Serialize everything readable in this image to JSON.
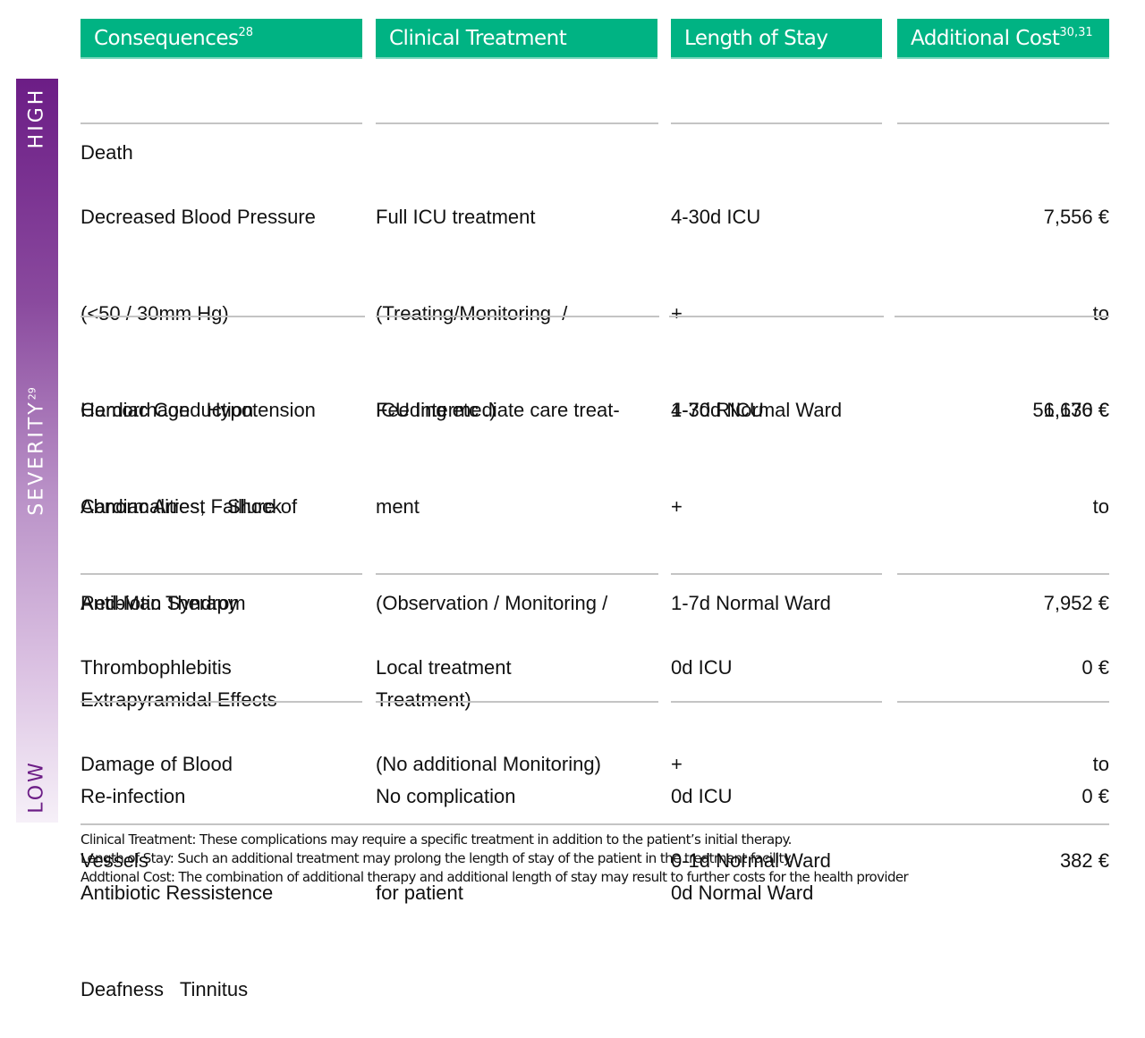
{
  "headers": {
    "consequences": {
      "label": "Consequences",
      "sup": "28"
    },
    "clinical_treatment": {
      "label": "Clinical Treatment"
    },
    "length_of_stay": {
      "label": "Length of Stay"
    },
    "additional_cost": {
      "label": "Additional Cost",
      "sup": "30,31"
    }
  },
  "severity_scale": {
    "high": "HIGH",
    "mid": "SEVERITY",
    "mid_sup": "29",
    "low": "LOW",
    "top_color": "#6c1d86",
    "bottom_color": "#f6f0f8"
  },
  "colors": {
    "header_bg": "#00b383",
    "rule": "#c4c4c4"
  },
  "rows": [
    {
      "consequences": [
        "Death"
      ],
      "treatment": [],
      "stay": [],
      "cost": []
    },
    {
      "consequences": [
        "Decreased Blood Pressure",
        "(<50 / 30mm Hg)",
        "Hemorrhage   Hypotension",
        "Cardiac Arrest    Shock",
        "Red-Man Syndrom"
      ],
      "treatment": [
        "Full ICU treatment",
        "(Treating/Monitoring  /",
        "Feeding etc .)"
      ],
      "stay": [
        "4-30d ICU",
        "+",
        "4-30d Normal Ward"
      ],
      "cost": [
        "7,556 €",
        "to",
        "56,670 €"
      ]
    },
    {
      "consequences": [
        "Cardiac Conduction",
        "Abnormalities, Faillure of",
        "Antibiotic Therapy",
        "Extrapyramidal Effects",
        "Re-infection",
        "Antibiotic Ressistence",
        "Deafness   Tinnitus"
      ],
      "treatment": [
        "ICU Intermediate care treat-",
        "ment",
        "(Observation / Monitoring /",
        "Treatment)"
      ],
      "stay": [
        "1-7d RICU",
        "+",
        "1-7d Normal Ward"
      ],
      "cost": [
        "1,136 €",
        "to",
        "7,952 €"
      ]
    },
    {
      "consequences": [
        "Thrombophlebitis",
        "Damage of Blood",
        "Vessels"
      ],
      "treatment": [
        "Local treatment",
        "(No additional Monitoring)"
      ],
      "stay": [
        "0d ICU",
        "+",
        "0-1d Normal Ward"
      ],
      "cost": [
        "0 €",
        "to",
        "382 €"
      ]
    },
    {
      "consequences": [],
      "treatment": [
        "No complication",
        "for patient"
      ],
      "stay": [
        "0d ICU",
        "0d Normal Ward"
      ],
      "cost": [
        "0 €"
      ]
    }
  ],
  "footnotes": [
    "Clinical Treatment: These complications may require a specific treatment in addition to the patient’s initial therapy.",
    "Length of Stay: Such an additional treatment may prolong the length of stay of the patient in the treatment facility.",
    "Addtional Cost: The combination of additional therapy and additional length of stay may result to further costs for the health provider"
  ]
}
